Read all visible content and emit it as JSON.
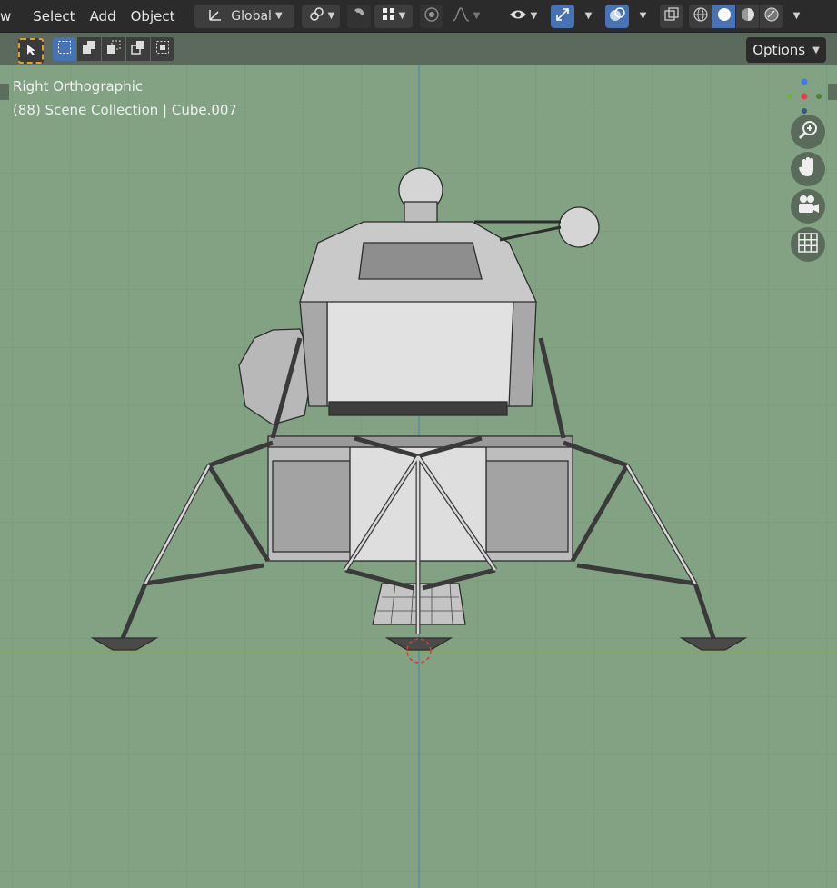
{
  "header": {
    "menu_partial": "w",
    "menu_select": "Select",
    "menu_add": "Add",
    "menu_object": "Object",
    "transform_orientation": "Global"
  },
  "toolbar": {
    "options_label": "Options"
  },
  "viewport": {
    "view_name": "Right Orthographic",
    "collection_info": "(88) Scene Collection | Cube.007"
  },
  "colors": {
    "viewport_bg": "#82a283",
    "header_bg": "#2b2b2b",
    "accent_blue": "#4772b3",
    "tool_outline": "#e0a12a"
  },
  "icons": {
    "transform_orientation": "orientation-axes-icon",
    "pivot": "pivot-link-icon",
    "snap": "snap-magnet-icon",
    "snap_target": "snap-grid-icon",
    "proportional": "proportional-edit-icon",
    "falloff": "falloff-curve-icon",
    "visibility": "eye-icon",
    "gizmo": "gizmo-arrows-icon",
    "overlays": "overlays-icon",
    "xray": "xray-icon",
    "shading_wire": "wireframe-sphere-icon",
    "shading_solid": "solid-sphere-icon",
    "shading_material": "material-sphere-icon",
    "shading_render": "render-sphere-icon",
    "zoom": "zoom-icon",
    "pan": "hand-icon",
    "camera": "camera-icon",
    "grid": "grid-icon"
  }
}
